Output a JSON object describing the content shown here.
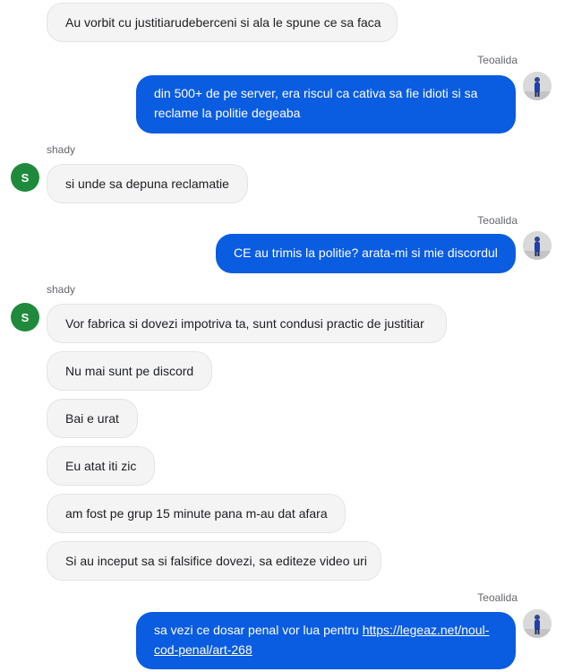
{
  "users": {
    "other": {
      "name": "shady",
      "avatar_letter": "S",
      "avatar_color": "#1f8a3b"
    },
    "me": {
      "name": "Teoalida"
    }
  },
  "colors": {
    "outgoing_bubble": "#0a5ce0",
    "incoming_bubble": "#f4f4f5"
  },
  "messages": [
    {
      "text": "Au vorbit cu justitiarudeberceni si ala le spune ce sa faca"
    },
    {
      "text": "din 500+ de pe server, era riscul ca cativa sa fie idioti si sa reclame la politie degeaba"
    },
    {
      "text": "si unde sa depuna reclamatie"
    },
    {
      "text": "CE au trimis la politie? arata-mi si mie discordul"
    },
    {
      "text": "Vor fabrica si dovezi impotriva ta, sunt condusi practic de justitiar"
    },
    {
      "text": "Nu mai sunt pe discord"
    },
    {
      "text": "Bai e urat"
    },
    {
      "text": "Eu atat iti zic"
    },
    {
      "text": "am fost pe grup 15 minute pana m-au dat afara"
    },
    {
      "text": "Si au inceput sa si falsifice dovezi, sa editeze video uri"
    },
    {
      "text": "sa vezi ce dosar penal vor lua pentru ",
      "link": "https://legeaz.net/noul-cod-penal/art-268"
    }
  ]
}
